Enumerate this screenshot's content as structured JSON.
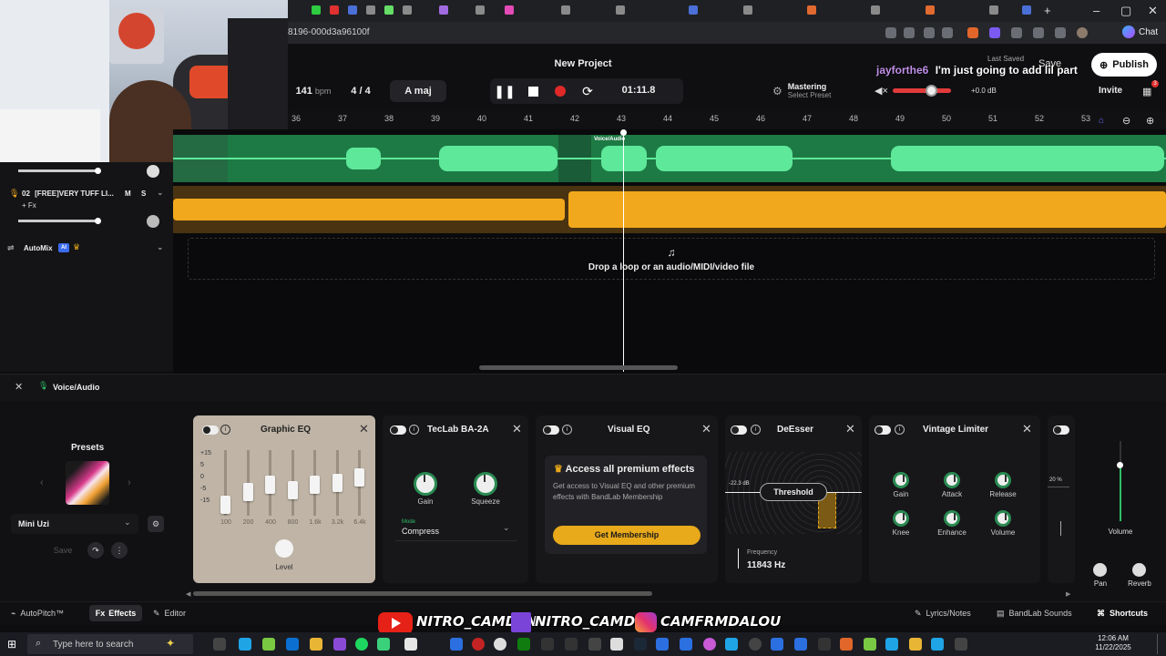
{
  "browser": {
    "url": "8196-000d3a96100f",
    "chat_label": "Chat"
  },
  "header": {
    "project_title": "New Project",
    "bpm": "141",
    "bpm_unit": "bpm",
    "time_signature": "4 / 4",
    "key": "A maj",
    "time_display": "01:11.8",
    "mastering_label": "Mastering",
    "mastering_preset": "Select Preset",
    "volume_db": "+0.0 dB",
    "last_saved": "Last Saved",
    "save_label": "Save",
    "publish_label": "Publish",
    "invite_label": "Invite",
    "notification_count": "3"
  },
  "chat_overlay": {
    "username": "jayforthe6",
    "message": "I'm just going to add lil part"
  },
  "ruler": {
    "bars": [
      "36",
      "37",
      "38",
      "39",
      "40",
      "41",
      "42",
      "43",
      "44",
      "45",
      "46",
      "47",
      "48",
      "49",
      "50",
      "51",
      "52",
      "53"
    ]
  },
  "tracks": [
    {
      "index": "02",
      "name": "[FREE]VERY TUFF LI...",
      "m": "M",
      "s": "S",
      "fx": "+ Fx"
    }
  ],
  "automix": {
    "label": "AutoMix",
    "badge": "AI"
  },
  "clip_label": "Voice/Audio",
  "drop_zone_text": "Drop a loop or an audio/MIDI/video file",
  "fx_panel": {
    "track_name": "Voice/Audio",
    "presets_label": "Presets",
    "preset_name": "Mini Uzi",
    "save_label": "Save"
  },
  "effects": {
    "graphic_eq": {
      "title": "Graphic EQ",
      "db_labels": [
        "+15",
        "5",
        "0",
        "-5",
        "-15"
      ],
      "freqs": [
        "100",
        "200",
        "400",
        "800",
        "1.6k",
        "3.2k",
        "6.4k"
      ],
      "level_label": "Level"
    },
    "teclab": {
      "title": "TecLab BA-2A",
      "gain_label": "Gain",
      "squeeze_label": "Squeeze",
      "mode_label": "Mode",
      "mode_value": "Compress"
    },
    "visual_eq": {
      "title": "Visual EQ",
      "promo_title": "Access all premium effects",
      "promo_body": "Get access to Visual EQ and other premium effects with BandLab Membership",
      "cta": "Get Membership"
    },
    "deesser": {
      "title": "DeEsser",
      "db_value": "-22.3 dB",
      "threshold_label": "Threshold",
      "frequency_label": "Frequency",
      "frequency_value": "11843 Hz"
    },
    "vintage_limiter": {
      "title": "Vintage Limiter",
      "knobs": [
        "Gain",
        "Attack",
        "Release",
        "Knee",
        "Enhance",
        "Volume"
      ]
    },
    "partial_card": {
      "value": "20 %"
    }
  },
  "mixer": {
    "volume_label": "Volume",
    "pan_label": "Pan",
    "reverb_label": "Reverb"
  },
  "footer": {
    "autopitch": "AutoPitch™",
    "effects": "Effects",
    "editor": "Editor",
    "lyrics": "Lyrics/Notes",
    "sounds": "BandLab Sounds",
    "shortcuts": "Shortcuts"
  },
  "socials": {
    "youtube": "NITRO_CAMDEN",
    "twitch": "NITRO_CAMDEN",
    "instagram": "CAMFRMDALOU"
  },
  "taskbar": {
    "search_placeholder": "Type here to search",
    "time": "12:06 AM",
    "date": "11/22/2025"
  },
  "colors": {
    "green_track": "#2fbf68",
    "orange_track": "#f2a81c",
    "accent_green": "#2a8b52",
    "record_red": "#e02828",
    "membership_yellow": "#e8a91a"
  }
}
